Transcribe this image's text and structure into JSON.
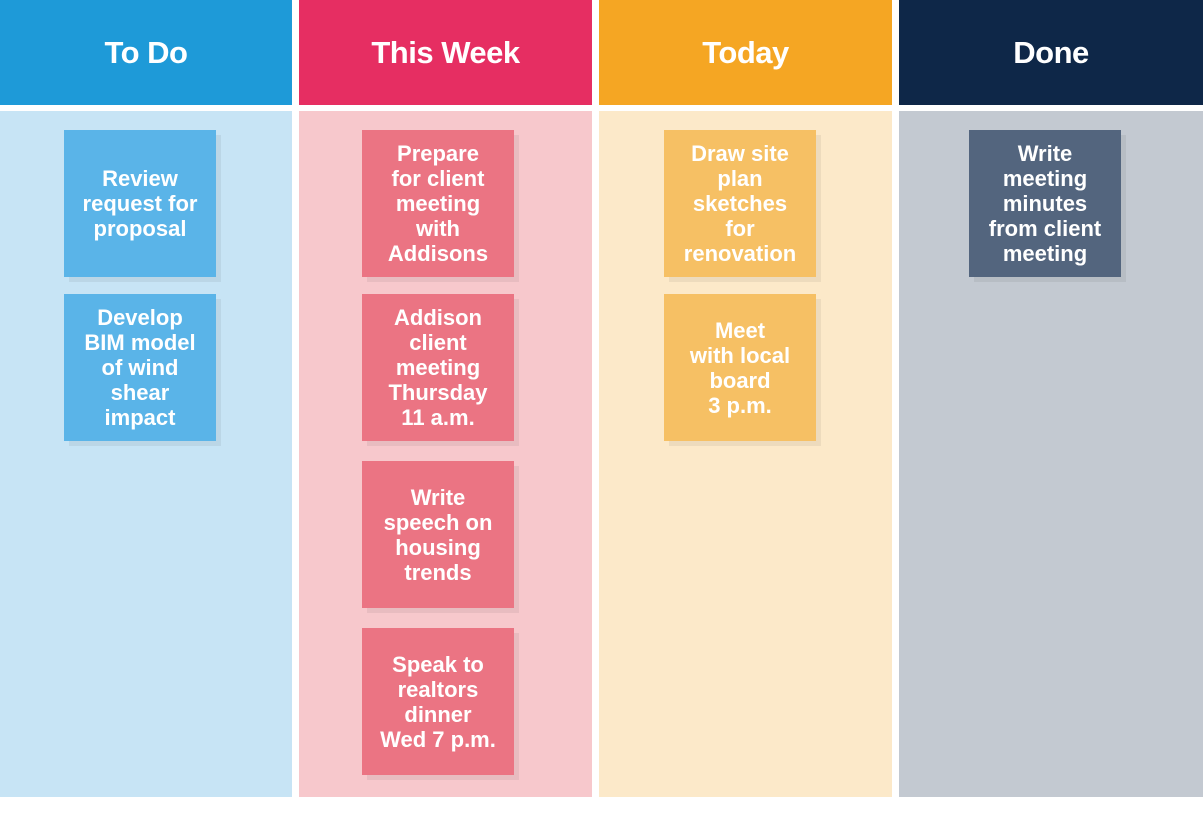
{
  "columns": [
    {
      "title": "To Do",
      "header_color": "#1e9ad8",
      "body_color": "#c7e4f5",
      "card_color": "#5ab4e8",
      "cards": [
        "Review\nrequest for\nproposal",
        "Develop\nBIM model\nof wind\nshear\nimpact"
      ]
    },
    {
      "title": "This Week",
      "header_color": "#e62e62",
      "body_color": "#f7c8cc",
      "card_color": "#eb7483",
      "cards": [
        "Prepare\nfor client\nmeeting\nwith\nAddisons",
        "Addison\nclient\nmeeting\nThursday\n11 a.m.",
        "Write\nspeech on\nhousing\ntrends",
        "Speak to\nrealtors\ndinner\nWed 7 p.m."
      ]
    },
    {
      "title": "Today",
      "header_color": "#f5a623",
      "body_color": "#fce9c9",
      "card_color": "#f6c064",
      "cards": [
        "Draw site\nplan\nsketches\nfor\nrenovation",
        "Meet\nwith local\nboard\n3 p.m."
      ]
    },
    {
      "title": "Done",
      "header_color": "#0e2748",
      "body_color": "#c3c9d1",
      "card_color": "#53657e",
      "cards": [
        "Write\nmeeting\nminutes\nfrom client\nmeeting"
      ]
    }
  ]
}
